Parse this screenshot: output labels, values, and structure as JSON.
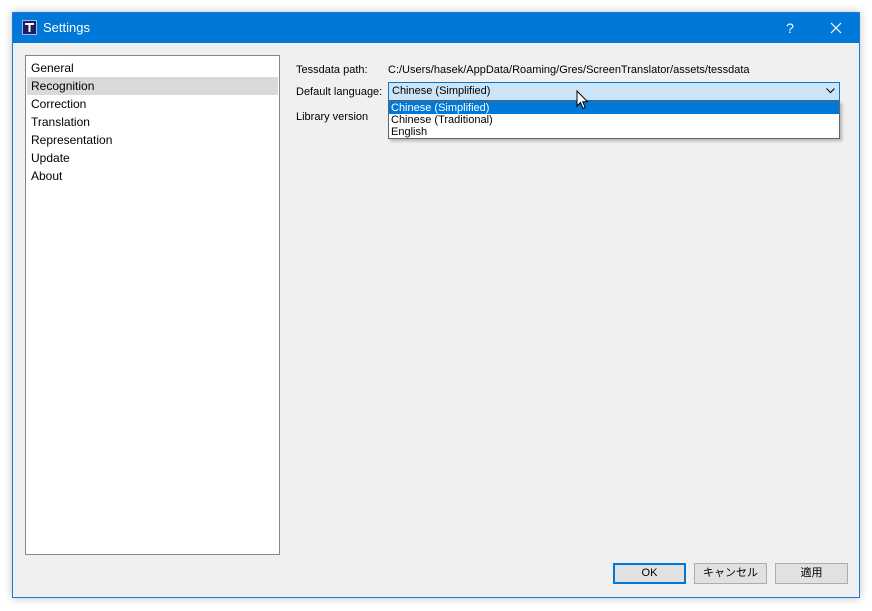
{
  "window": {
    "title": "Settings",
    "help_label": "?",
    "accent_color": "#0078d7"
  },
  "sidebar": {
    "items": [
      {
        "label": "General",
        "selected": false
      },
      {
        "label": "Recognition",
        "selected": true
      },
      {
        "label": "Correction",
        "selected": false
      },
      {
        "label": "Translation",
        "selected": false
      },
      {
        "label": "Representation",
        "selected": false
      },
      {
        "label": "Update",
        "selected": false
      },
      {
        "label": "About",
        "selected": false
      }
    ]
  },
  "recognition": {
    "tessdata_label": "Tessdata path:",
    "tessdata_value": "C:/Users/hasek/AppData/Roaming/Gres/ScreenTranslator/assets/tessdata",
    "language_label": "Default language:",
    "language_selected": "Chinese (Simplified)",
    "language_options": [
      "Chinese (Simplified)",
      "Chinese (Traditional)",
      "English"
    ],
    "library_label": "Library version"
  },
  "buttons": {
    "ok": "OK",
    "cancel": "キャンセル",
    "apply": "適用"
  },
  "icons": {
    "app": "screen-translator-app-icon",
    "close": "close-icon",
    "dropdown": "chevron-down-icon",
    "cursor": "mouse-pointer-icon"
  }
}
